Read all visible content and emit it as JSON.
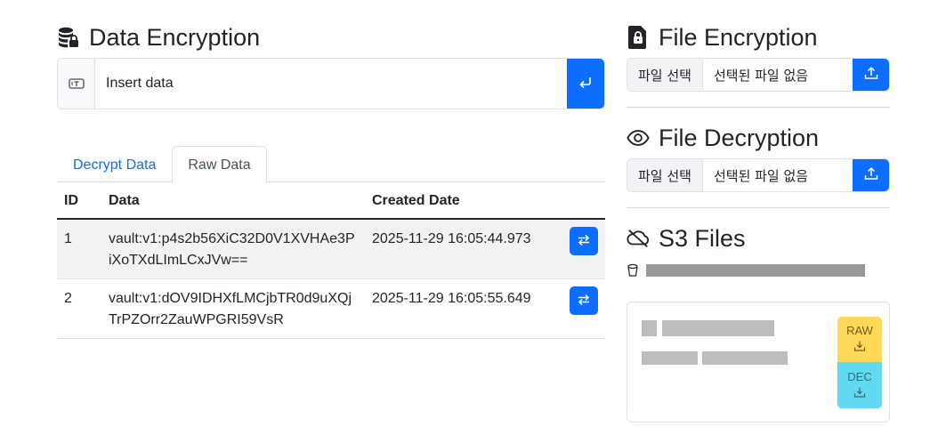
{
  "data_encryption": {
    "title": "Data Encryption",
    "input_placeholder": "Insert data"
  },
  "tabs": [
    {
      "label": "Decrypt Data",
      "active": false
    },
    {
      "label": "Raw Data",
      "active": true
    }
  ],
  "table": {
    "headers": {
      "id": "ID",
      "data": "Data",
      "created": "Created Date"
    },
    "rows": [
      {
        "id": "1",
        "data": "vault:v1:p4s2b56XiC32D0V1XVHAe3PiXoTXdLImLCxJVw==",
        "created": "2025-11-29 16:05:44.973"
      },
      {
        "id": "2",
        "data": "vault:v1:dOV9IDHXfLMCjbTR0d9uXQjTrPZOrr2ZauWPGRI59VsR",
        "created": "2025-11-29 16:05:55.649"
      }
    ]
  },
  "file_encryption": {
    "title": "File Encryption",
    "choose_label": "파일 선택",
    "file_status": "선택된 파일 없음"
  },
  "file_decryption": {
    "title": "File Decryption",
    "choose_label": "파일 선택",
    "file_status": "선택된 파일 없음"
  },
  "s3": {
    "title": "S3 Files",
    "raw_label": "RAW",
    "dec_label": "DEC"
  },
  "colors": {
    "primary": "#0d6efd",
    "warning": "#ffd857",
    "info": "#61d9f0"
  },
  "icons": {
    "data_title": "database-lock-icon",
    "input_prefix": "text-cursor-icon",
    "submit": "enter-arrow-icon",
    "swap": "swap-arrows-icon",
    "file_encryption": "file-lock-icon",
    "file_decryption": "eye-icon",
    "upload": "upload-icon",
    "s3": "cloud-slash-icon",
    "bucket": "bucket-icon",
    "download": "download-icon"
  }
}
